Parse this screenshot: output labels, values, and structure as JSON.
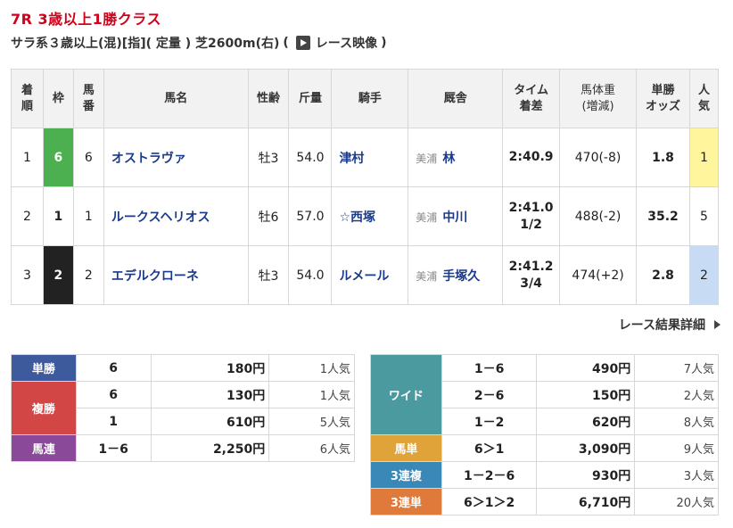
{
  "race": {
    "title": "7R 3歳以上1勝クラス",
    "conditions": "サラ系３歳以上(混)[指]( 定量 ) 芝2600m(右)",
    "paren_open": "(",
    "paren_close": ")",
    "video_label": "レース映像"
  },
  "table": {
    "headers": [
      "着\n順",
      "枠",
      "馬\n番",
      "馬名",
      "性齢",
      "斤量",
      "騎手",
      "厩舎",
      "タイム\n着差",
      "馬体重\n(増減)",
      "単勝\nオッズ",
      "人\n気"
    ],
    "rows": [
      {
        "rank": "1",
        "waku": "6",
        "num": "6",
        "horse": "オストラヴァ",
        "sexage": "牡3",
        "weight": "54.0",
        "jockey": "津村",
        "region": "美浦",
        "trainer": "林",
        "time": "2:40.9",
        "margin": "",
        "body": "470(-8)",
        "odds": "1.8",
        "pop": "1"
      },
      {
        "rank": "2",
        "waku": "1",
        "num": "1",
        "horse": "ルークスヘリオス",
        "sexage": "牡6",
        "weight": "57.0",
        "jockey": "☆西塚",
        "region": "美浦",
        "trainer": "中川",
        "time": "2:41.0",
        "margin": "1/2",
        "body": "488(-2)",
        "odds": "35.2",
        "pop": "5"
      },
      {
        "rank": "3",
        "waku": "2",
        "num": "2",
        "horse": "エデルクローネ",
        "sexage": "牡3",
        "weight": "54.0",
        "jockey": "ルメール",
        "region": "美浦",
        "trainer": "手塚久",
        "time": "2:41.2",
        "margin": "3/4",
        "body": "474(+2)",
        "odds": "2.8",
        "pop": "2"
      }
    ]
  },
  "detail_link": "レース結果詳細",
  "payouts_left": {
    "tansho": {
      "label": "単勝",
      "combo": "6",
      "amount": "180円",
      "pop": "1人気"
    },
    "fukusho": {
      "label": "複勝",
      "rows": [
        {
          "combo": "6",
          "amount": "130円",
          "pop": "1人気"
        },
        {
          "combo": "1",
          "amount": "610円",
          "pop": "5人気"
        }
      ]
    },
    "umaren": {
      "label": "馬連",
      "combo": "1－6",
      "amount": "2,250円",
      "pop": "6人気"
    }
  },
  "payouts_right": {
    "wide": {
      "label": "ワイド",
      "rows": [
        {
          "combo": "1－6",
          "amount": "490円",
          "pop": "7人気"
        },
        {
          "combo": "2－6",
          "amount": "150円",
          "pop": "2人気"
        },
        {
          "combo": "1－2",
          "amount": "620円",
          "pop": "8人気"
        }
      ]
    },
    "umatan": {
      "label": "馬単",
      "combo": "6＞1",
      "amount": "3,090円",
      "pop": "9人気"
    },
    "sanrenpuku": {
      "label": "3連複",
      "combo": "1－2－6",
      "amount": "930円",
      "pop": "3人気"
    },
    "sanrentan": {
      "label": "3連単",
      "combo": "6＞1＞2",
      "amount": "6,710円",
      "pop": "20人気"
    }
  },
  "colors": {
    "title_red": "#d0021b",
    "waku_6": "#4caf50",
    "waku_1": "#ffffff",
    "waku_2": "#222222",
    "pop_1": "#fff59d",
    "pop_2": "#c8dbf5",
    "link_blue": "#1a3a8c"
  },
  "icons": {
    "video": "video-play-icon",
    "detail": "triangle-right-icon"
  }
}
